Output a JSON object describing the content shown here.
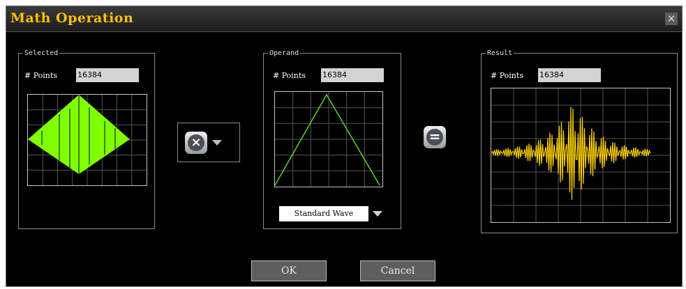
{
  "window": {
    "title": "Math Operation",
    "close_icon": "close-icon"
  },
  "selected": {
    "legend": "Selected",
    "points_label": "# Points",
    "points_value": "16384",
    "waveform_color": "#7fff00"
  },
  "operator": {
    "icon": "multiply-icon",
    "symbol": "×",
    "dropdown_icon": "chevron-down-icon"
  },
  "operand": {
    "legend": "Operand",
    "points_label": "# Points",
    "points_value": "16384",
    "waveform_color": "#5dd12a",
    "wave_type": "Standard Wave"
  },
  "equals": {
    "icon": "equals-icon",
    "symbol": "="
  },
  "result": {
    "legend": "Result",
    "points_label": "# Points",
    "points_value": "16384",
    "waveform_color": "#ffd400"
  },
  "buttons": {
    "ok": "OK",
    "cancel": "Cancel"
  }
}
